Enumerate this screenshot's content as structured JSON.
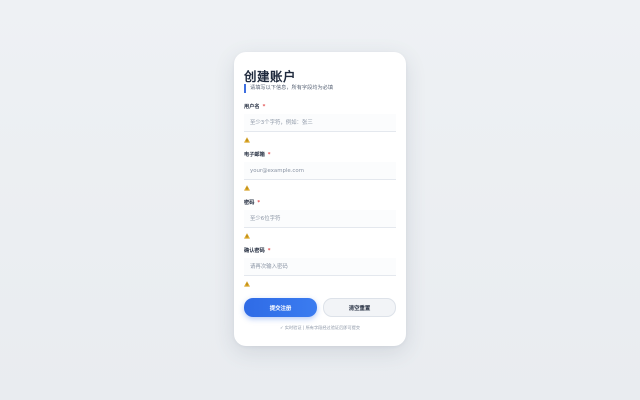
{
  "form": {
    "title": "创建账户",
    "subtitle": "请填写以下信息，所有字段均为必填",
    "required_mark": "*",
    "fields": [
      {
        "label": "用户名",
        "placeholder": "至少3个字符，例如：张三",
        "value": ""
      },
      {
        "label": "电子邮箱",
        "placeholder": "your@example.com",
        "value": ""
      },
      {
        "label": "密码",
        "placeholder": "至少6位字符",
        "value": ""
      },
      {
        "label": "确认密码",
        "placeholder": "请再次输入密码",
        "value": ""
      }
    ],
    "submit_label": "提交注册",
    "reset_label": "清空重置",
    "footer": "✓ 实时验证 | 所有字段经过验证后即可提交"
  },
  "colors": {
    "accent": "#2f6be6",
    "required": "#e24c4c",
    "warning": "#e0a400"
  },
  "icons": {
    "validation": "warning-triangle-icon"
  }
}
